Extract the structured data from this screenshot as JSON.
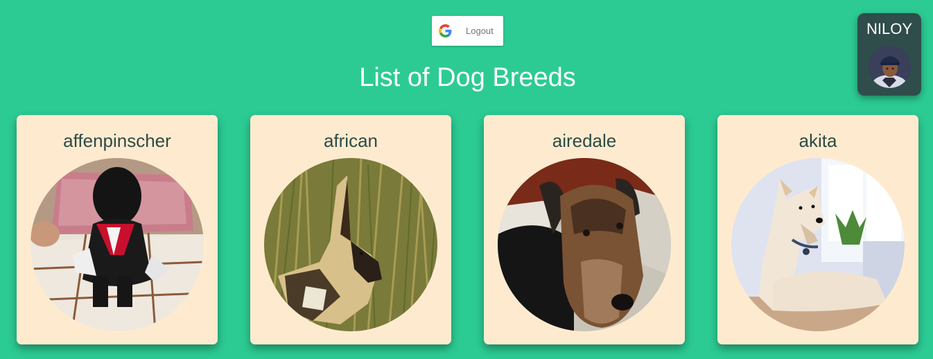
{
  "header": {
    "logout_label": "Logout",
    "google_icon": "google-g-icon"
  },
  "page": {
    "title": "List of Dog Breeds"
  },
  "user": {
    "name": "NILOY",
    "avatar": "user-avatar-photo"
  },
  "breeds": [
    {
      "name": "affenpinscher",
      "image": "affenpinscher-photo"
    },
    {
      "name": "african",
      "image": "african-photo"
    },
    {
      "name": "airedale",
      "image": "airedale-photo"
    },
    {
      "name": "akita",
      "image": "akita-photo"
    }
  ],
  "colors": {
    "background": "#2ccb94",
    "card": "#feebcf",
    "card_text": "#2e4a47",
    "user_card": "#2f4d4a",
    "title": "#ffffff"
  }
}
